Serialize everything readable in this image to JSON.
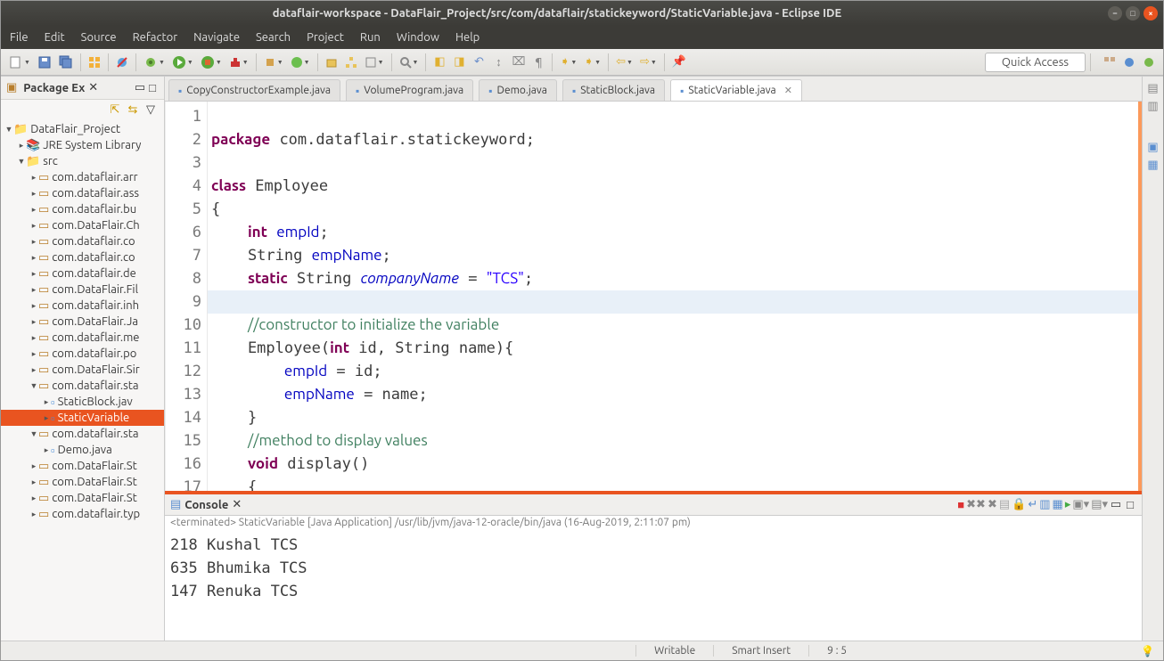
{
  "window": {
    "title": "dataflair-workspace - DataFlair_Project/src/com/dataflair/statickeyword/StaticVariable.java - Eclipse IDE"
  },
  "menubar": [
    "File",
    "Edit",
    "Source",
    "Refactor",
    "Navigate",
    "Search",
    "Project",
    "Run",
    "Window",
    "Help"
  ],
  "toolbar": {
    "quick_access": "Quick Access"
  },
  "package_explorer": {
    "title": "Package Ex",
    "project": "DataFlair_Project",
    "jre": "JRE System Library",
    "src": "src",
    "packages": [
      "com.dataflair.arr",
      "com.dataflair.ass",
      "com.dataflair.bu",
      "com.DataFlair.Ch",
      "com.dataflair.co",
      "com.dataflair.co",
      "com.dataflair.de",
      "com.DataFlair.Fil",
      "com.dataflair.inh",
      "com.DataFlair.Ja",
      "com.dataflair.me",
      "com.dataflair.po",
      "com.DataFlair.Sir"
    ],
    "open_pkg": "com.dataflair.sta",
    "open_children": [
      "StaticBlock.jav",
      "StaticVariable"
    ],
    "after_open_pkg": "com.dataflair.sta",
    "after_open_child": "Demo.java",
    "trailing_packages": [
      "com.DataFlair.St",
      "com.DataFlair.St",
      "com.DataFlair.St",
      "com.dataflair.typ"
    ]
  },
  "tabs": [
    {
      "label": "CopyConstructorExample.java"
    },
    {
      "label": "VolumeProgram.java"
    },
    {
      "label": "Demo.java"
    },
    {
      "label": "StaticBlock.java"
    },
    {
      "label": "StaticVariable.java",
      "active": true
    }
  ],
  "editor": {
    "line_numbers": [
      "1",
      "2",
      "3",
      "4",
      "5",
      "6",
      "7",
      "8",
      "9",
      "10",
      "11",
      "12",
      "13",
      "14",
      "15",
      "16",
      "17"
    ]
  },
  "console": {
    "title": "Console",
    "meta": "<terminated> StaticVariable [Java Application] /usr/lib/jvm/java-12-oracle/bin/java (16-Aug-2019, 2:11:07 pm)",
    "output": [
      "218 Kushal TCS",
      "635 Bhumika TCS",
      "147 Renuka TCS"
    ]
  },
  "status": {
    "writable": "Writable",
    "insert": "Smart Insert",
    "pos": "9 : 5"
  }
}
